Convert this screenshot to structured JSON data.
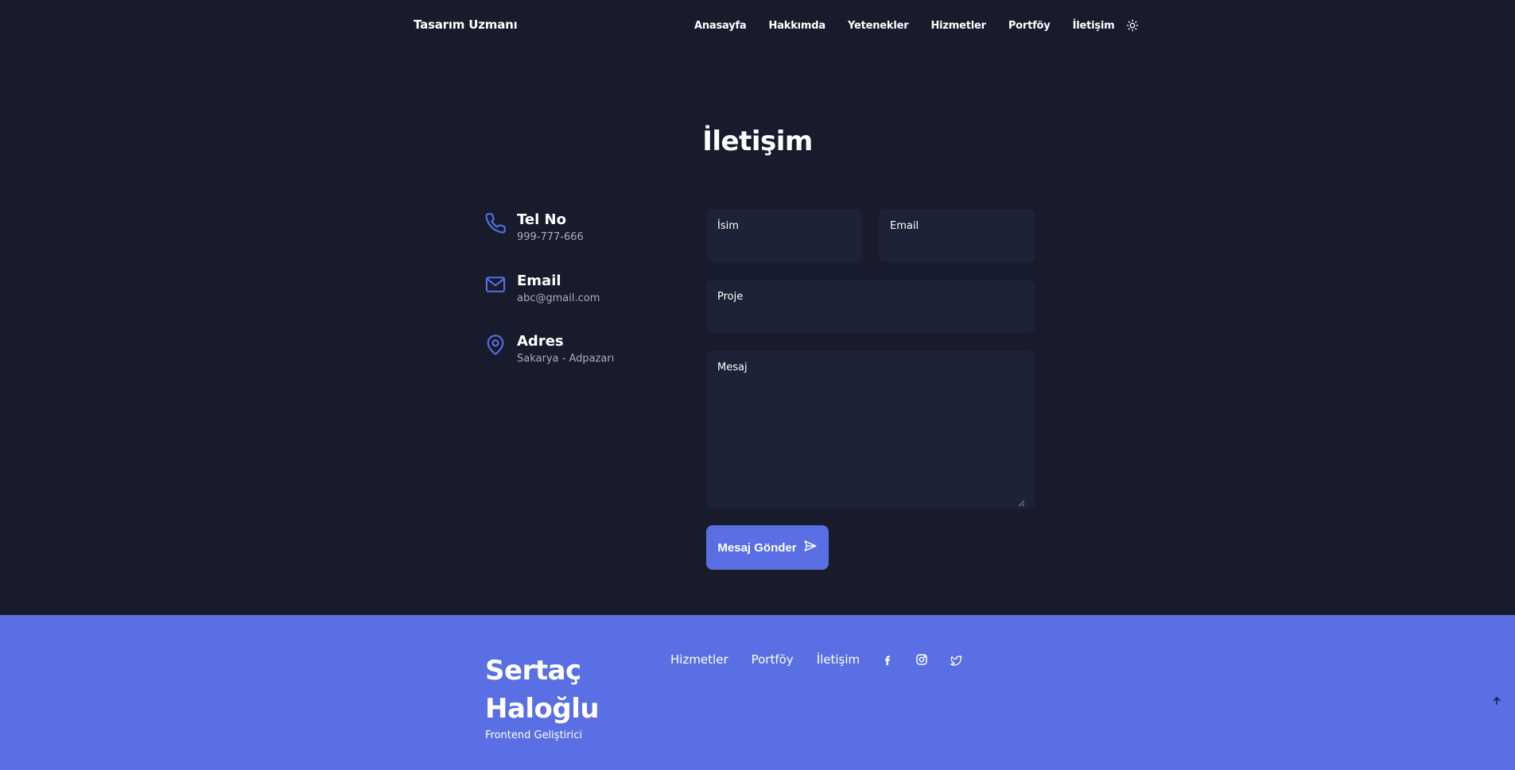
{
  "header": {
    "logo": "Tasarım Uzmanı",
    "nav": [
      "Anasayfa",
      "Hakkımda",
      "Yetenekler",
      "Hizmetler",
      "Portföy",
      "İletişim"
    ],
    "theme_icon": "sun-icon"
  },
  "contact": {
    "title": "İletişim",
    "info": [
      {
        "icon": "phone-icon",
        "title": "Tel No",
        "value": "999-777-666"
      },
      {
        "icon": "mail-icon",
        "title": "Email",
        "value": "abc@gmail.com"
      },
      {
        "icon": "location-pin-icon",
        "title": "Adres",
        "value": "Sakarya - Adpazarı"
      }
    ],
    "form": {
      "name_label": "İsim",
      "email_label": "Email",
      "project_label": "Proje",
      "message_label": "Mesaj",
      "submit_label": "Mesaj Gönder",
      "submit_icon": "send-icon"
    }
  },
  "footer": {
    "name_line1": "Sertaç",
    "name_line2": "Haloğlu",
    "role": "Frontend Geliştirici",
    "links": [
      "Hizmetler",
      "Portföy",
      "İletişim"
    ],
    "social_icons": [
      "facebook-icon",
      "instagram-icon",
      "twitter-icon"
    ],
    "scroll_top_icon": "arrow-up-icon"
  },
  "colors": {
    "background": "#171b2b",
    "input_background": "#1e2236",
    "accent": "#5a6fe3",
    "muted_text": "#a9adbd"
  }
}
